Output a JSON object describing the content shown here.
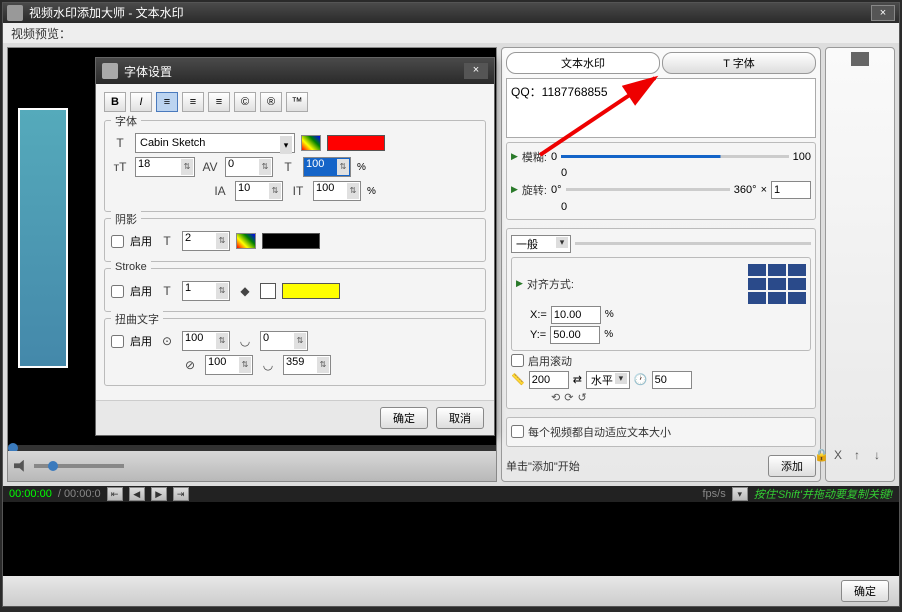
{
  "window": {
    "title": "视频水印添加大师 - 文本水印",
    "close": "×"
  },
  "subtitle": "视频预览：",
  "dialog": {
    "title": "字体设置",
    "close": "×",
    "format": {
      "bold": "B",
      "italic": "I",
      "align_l": "≡",
      "align_c": "≡",
      "align_r": "≡",
      "copyright": "©",
      "registered": "®",
      "trademark": "™"
    },
    "font_legend": "字体",
    "font_family": "Cabin Sketch",
    "font_size": "18",
    "kerning": "0",
    "opacity": "100",
    "char_spacing": "10",
    "line_height": "100",
    "shadow_legend": "阴影",
    "enable": "启用",
    "shadow_size": "2",
    "stroke_legend": "Stroke",
    "stroke_size": "1",
    "warp_legend": "扭曲文字",
    "warp_h1": "100",
    "warp_h2": "0",
    "warp_v1": "100",
    "warp_v2": "359",
    "ok": "确定",
    "cancel": "取消",
    "percent": "%"
  },
  "panel": {
    "tab_text": "文本水印",
    "tab_font": "T 字体",
    "text_value": "QQ：1187768855",
    "blur_label": "模糊:",
    "blur_min": "0",
    "blur_max": "100",
    "blur_val": "0",
    "rotate_label": "旋转:",
    "rotate_min": "0°",
    "rotate_max": "360°",
    "rotate_mult": "×",
    "rotate_times": "1",
    "rotate_val": "0",
    "mode": "一般",
    "align_label": "对齐方式:",
    "x_label": "X:=",
    "x_val": "10.00",
    "y_label": "Y:=",
    "y_val": "50.00",
    "scroll_enable": "启用滚动",
    "scroll_speed": "200",
    "scroll_dir": "水平",
    "scroll_step": "50",
    "fit_label": "每个视频都自动适应文本大小",
    "add_hint": "单击\"添加\"开始",
    "add_btn": "添加",
    "percent": "%"
  },
  "side_icons": {
    "lock": "🔒",
    "del": "X",
    "up": "↑",
    "down": "↓"
  },
  "timeline": {
    "time": "00:00:00",
    "total": "/ 00:00:0",
    "fps": "fps/s",
    "hint": "按住'Shift'并拖动要复制关键!"
  },
  "footer": {
    "ok": "确定"
  }
}
